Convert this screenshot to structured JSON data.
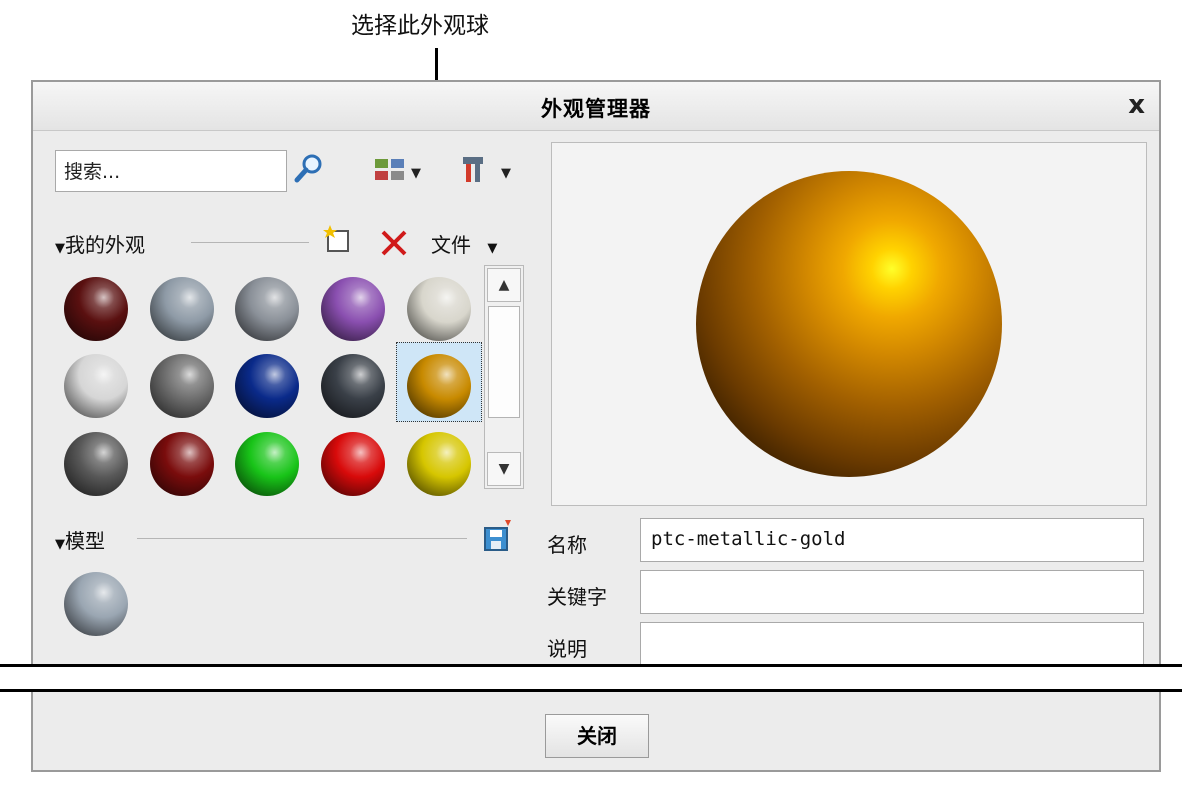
{
  "annotation": {
    "text": "选择此外观球"
  },
  "dialog": {
    "title": "外观管理器",
    "close_glyph": "x",
    "search": {
      "placeholder": "搜索..."
    },
    "my_appearances": {
      "label": "我的外观",
      "file_menu_label": "文件"
    },
    "palette": [
      {
        "name": "dark-red-texture",
        "color": "#5a1010"
      },
      {
        "name": "steel-blue-grey",
        "color": "#8e9aa6"
      },
      {
        "name": "grey-metal",
        "color": "#8a9098"
      },
      {
        "name": "purple",
        "color": "#8a4fb0"
      },
      {
        "name": "off-white",
        "color": "#d8d6cc"
      },
      {
        "name": "light-grey",
        "color": "#d6d6d6"
      },
      {
        "name": "dark-grey",
        "color": "#6e6e6e"
      },
      {
        "name": "dark-blue",
        "color": "#0a2a8a"
      },
      {
        "name": "dark-slate-texture",
        "color": "#3a4048"
      },
      {
        "name": "metallic-gold",
        "color": "#c88a00",
        "selected": true
      },
      {
        "name": "charcoal",
        "color": "#585858"
      },
      {
        "name": "maroon",
        "color": "#7a0c0c"
      },
      {
        "name": "green",
        "color": "#18c418"
      },
      {
        "name": "red",
        "color": "#d80a0a"
      },
      {
        "name": "yellow",
        "color": "#d6c600"
      }
    ],
    "model": {
      "label": "模型",
      "appearance_color": "#9aa6b2"
    },
    "properties": {
      "name_label": "名称",
      "name_value": "ptc-metallic-gold",
      "keyword_label": "关键字",
      "keyword_value": "",
      "description_label": "说明",
      "description_value": ""
    },
    "close_button": "关闭"
  }
}
